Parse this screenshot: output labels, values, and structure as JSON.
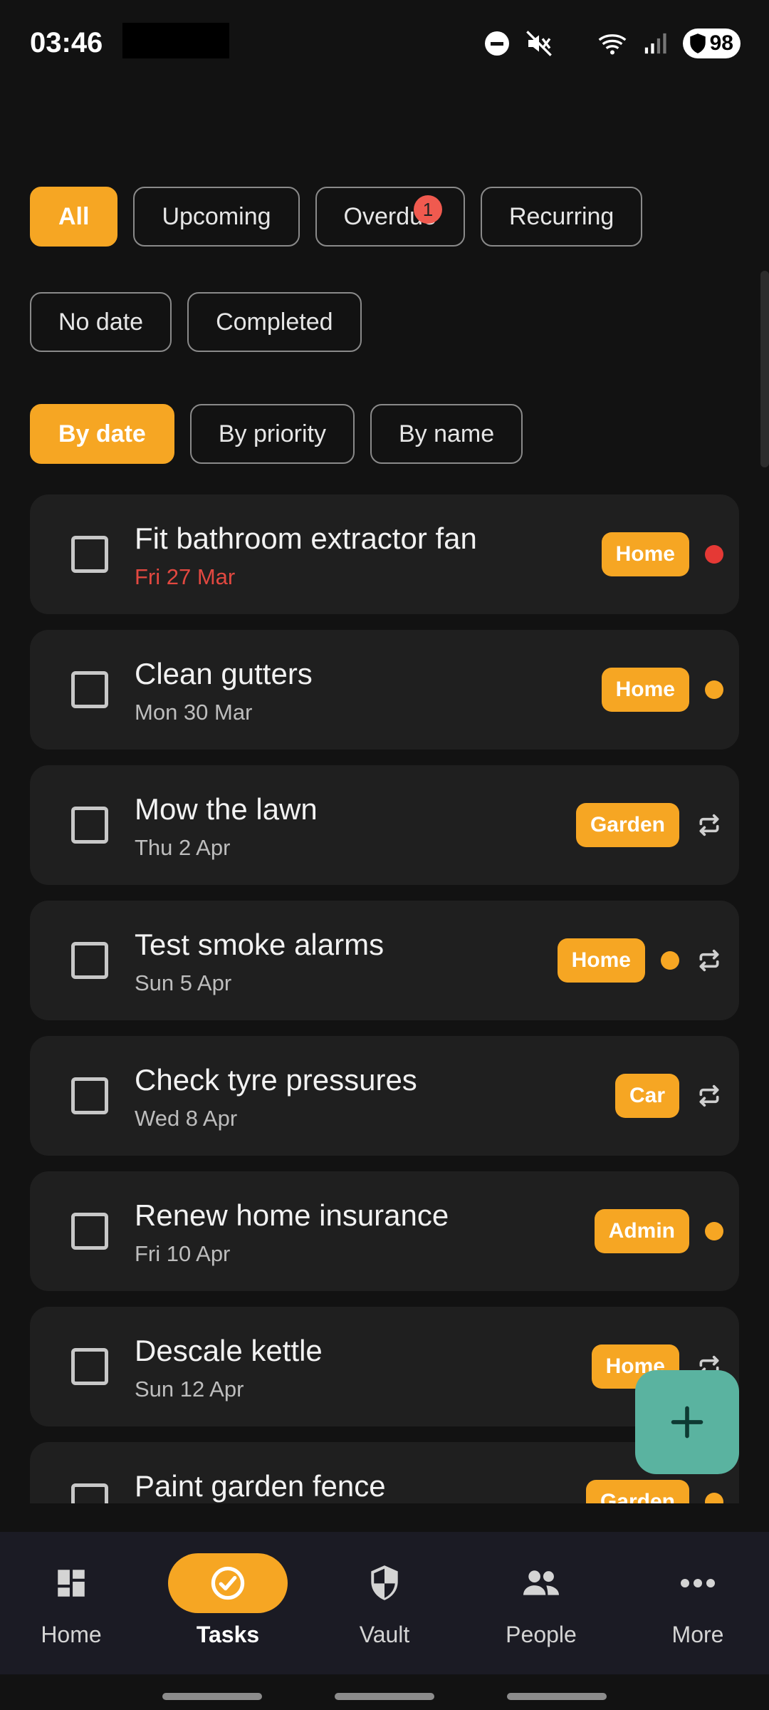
{
  "status": {
    "time": "03:46",
    "battery": "98"
  },
  "filters": [
    {
      "label": "All",
      "active": true
    },
    {
      "label": "Upcoming",
      "active": false
    },
    {
      "label": "Overdue",
      "active": false,
      "badge": "1"
    },
    {
      "label": "Recurring",
      "active": false
    },
    {
      "label": "No date",
      "active": false
    },
    {
      "label": "Completed",
      "active": false
    }
  ],
  "sorts": [
    {
      "label": "By date",
      "active": true
    },
    {
      "label": "By priority",
      "active": false
    },
    {
      "label": "By name",
      "active": false
    }
  ],
  "tasks": [
    {
      "title": "Fit bathroom extractor fan",
      "date": "Fri 27 Mar",
      "overdue": true,
      "tag": "Home",
      "priority_color": "#e53935",
      "recurring": false
    },
    {
      "title": "Clean gutters",
      "date": "Mon 30 Mar",
      "overdue": false,
      "tag": "Home",
      "priority_color": "#f6a623",
      "recurring": false
    },
    {
      "title": "Mow the lawn",
      "date": "Thu 2 Apr",
      "overdue": false,
      "tag": "Garden",
      "priority_color": null,
      "recurring": true
    },
    {
      "title": "Test smoke alarms",
      "date": "Sun 5 Apr",
      "overdue": false,
      "tag": "Home",
      "priority_color": "#f6a623",
      "recurring": true
    },
    {
      "title": "Check tyre pressures",
      "date": "Wed 8 Apr",
      "overdue": false,
      "tag": "Car",
      "priority_color": null,
      "recurring": true
    },
    {
      "title": "Renew home insurance",
      "date": "Fri 10 Apr",
      "overdue": false,
      "tag": "Admin",
      "priority_color": "#f6a623",
      "recurring": false
    },
    {
      "title": "Descale kettle",
      "date": "Sun 12 Apr",
      "overdue": false,
      "tag": "Home",
      "priority_color": null,
      "recurring": true
    },
    {
      "title": "Paint garden fence",
      "date": "",
      "overdue": false,
      "tag": "Garden",
      "priority_color": "#f6a623",
      "recurring": false
    }
  ],
  "nav": [
    {
      "label": "Home",
      "icon": "dashboard-icon",
      "active": false
    },
    {
      "label": "Tasks",
      "icon": "check-circle-icon",
      "active": true
    },
    {
      "label": "Vault",
      "icon": "shield-icon",
      "active": false
    },
    {
      "label": "People",
      "icon": "people-icon",
      "active": false
    },
    {
      "label": "More",
      "icon": "more-horizontal-icon",
      "active": false
    }
  ],
  "colors": {
    "accent": "#f6a623",
    "fab": "#5ab3a0",
    "overdue": "#e24840"
  }
}
